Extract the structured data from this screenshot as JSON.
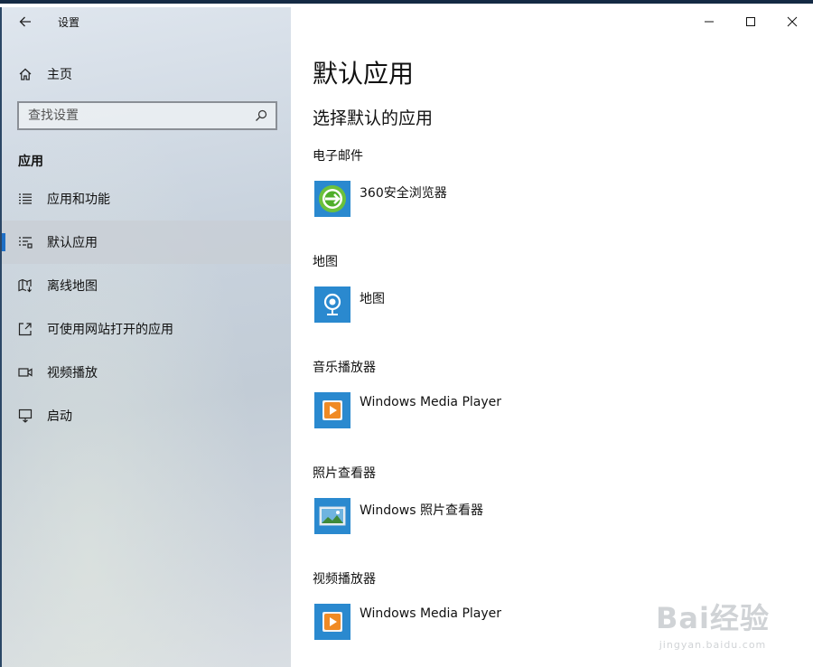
{
  "titlebar": {
    "app_title": "设置"
  },
  "sidebar": {
    "home_label": "主页",
    "search_placeholder": "查找设置",
    "section_title": "应用",
    "items": [
      {
        "label": "应用和功能",
        "icon": "apps-list-icon"
      },
      {
        "label": "默认应用",
        "icon": "default-apps-icon",
        "selected": true
      },
      {
        "label": "离线地图",
        "icon": "offline-map-icon"
      },
      {
        "label": "可使用网站打开的应用",
        "icon": "open-website-icon"
      },
      {
        "label": "视频播放",
        "icon": "video-icon"
      },
      {
        "label": "启动",
        "icon": "startup-icon"
      }
    ]
  },
  "main": {
    "title": "默认应用",
    "subtitle": "选择默认的应用",
    "categories": [
      {
        "label": "电子邮件",
        "app": "360安全浏览器",
        "icon": "browser-360-icon"
      },
      {
        "label": "地图",
        "app": "地图",
        "icon": "maps-icon"
      },
      {
        "label": "音乐播放器",
        "app": "Windows Media Player",
        "icon": "media-player-icon"
      },
      {
        "label": "照片查看器",
        "app": "Windows 照片查看器",
        "icon": "photo-viewer-icon"
      },
      {
        "label": "视频播放器",
        "app": "Windows Media Player",
        "icon": "media-player-icon"
      }
    ]
  },
  "watermark": {
    "main": "Bai经验",
    "sub": "jingyan.baidu.com"
  },
  "colors": {
    "accent": "#1f6fc5",
    "tile": "#2a89cf"
  }
}
